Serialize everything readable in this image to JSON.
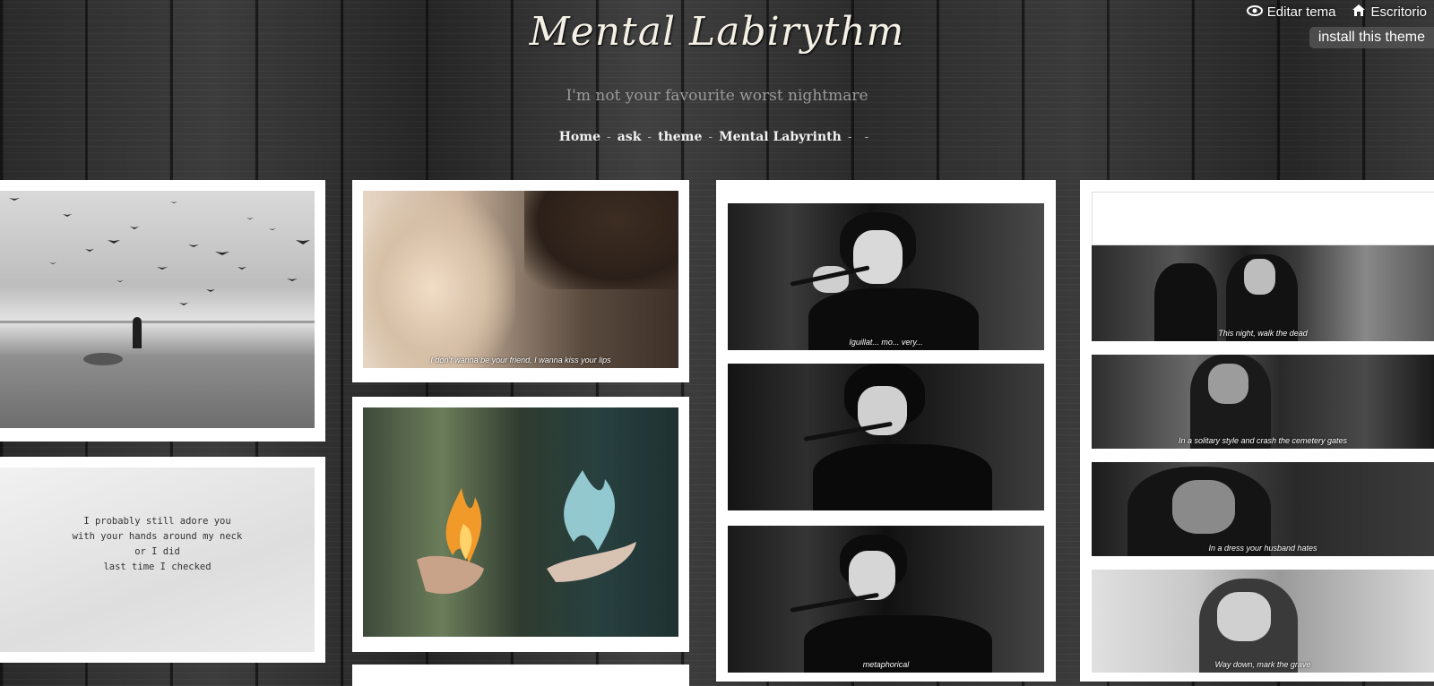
{
  "topbar": {
    "edit_label": "Editar tema",
    "dashboard_label": "Escritorio",
    "install_label": "install this theme"
  },
  "header": {
    "title": "Mental Labirythm",
    "description": "I'm not your favourite worst nightmare"
  },
  "nav": {
    "items": [
      "Home",
      "ask",
      "theme",
      "Mental Labyrinth"
    ],
    "separator": "-"
  },
  "posts": {
    "beach": {
      "icon": "photo-beach-birds"
    },
    "quote": {
      "lines": [
        "I probably still adore you",
        "with your hands around my neck",
        "or I did",
        "last time I checked"
      ]
    },
    "kiss": {
      "caption": "I don't wanna be your friend, I wanna kiss your lips"
    },
    "fire": {
      "icon": "photo-fire-hands"
    },
    "singer1": {
      "caption": "Iguillat... mo... very..."
    },
    "singer2": {
      "caption": ""
    },
    "singer3": {
      "caption": "metaphorical"
    },
    "gif1": {
      "caption": "This night, walk the dead"
    },
    "gif2": {
      "caption": "In a solitary style and crash the cemetery gates"
    },
    "gif3": {
      "caption": "In a dress your husband hates"
    },
    "gif4": {
      "caption": "Way down, mark the grave"
    }
  },
  "colors": {
    "title": "#f4f0e6",
    "description": "#9a9a9a",
    "post_bg": "#ffffff"
  }
}
